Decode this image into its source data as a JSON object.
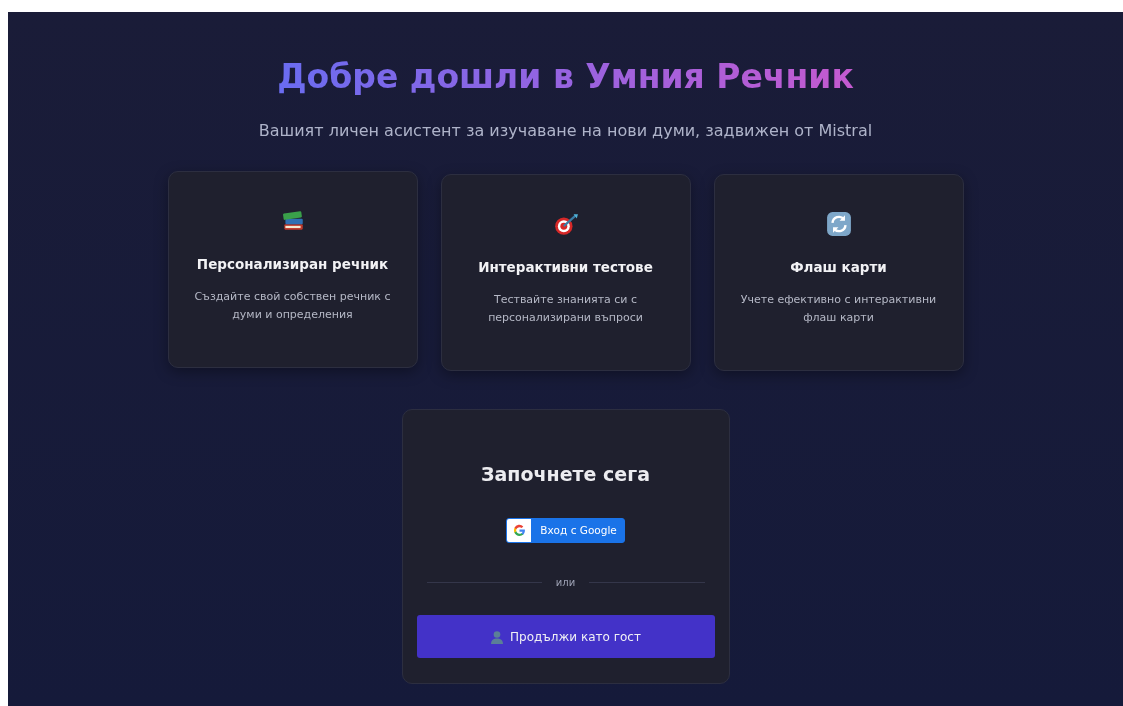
{
  "hero": {
    "title": "Добре дошли в Умния Речник",
    "subtitle": "Вашият личен асистент за изучаване на нови думи, задвижен от Mistral"
  },
  "features": [
    {
      "title": "Персонализиран речник",
      "text": "Създайте свой собствен речник с думи и определения"
    },
    {
      "title": "Интерактивни тестове",
      "text": "Тествайте знанията си с персонализирани въпроси"
    },
    {
      "title": "Флаш карти",
      "text": "Учете ефективно с интерактивни флаш карти"
    }
  ],
  "login": {
    "title": "Започнете сега",
    "google_button": "Вход с Google",
    "divider": "или",
    "guest_button": "Продължи като гост"
  }
}
